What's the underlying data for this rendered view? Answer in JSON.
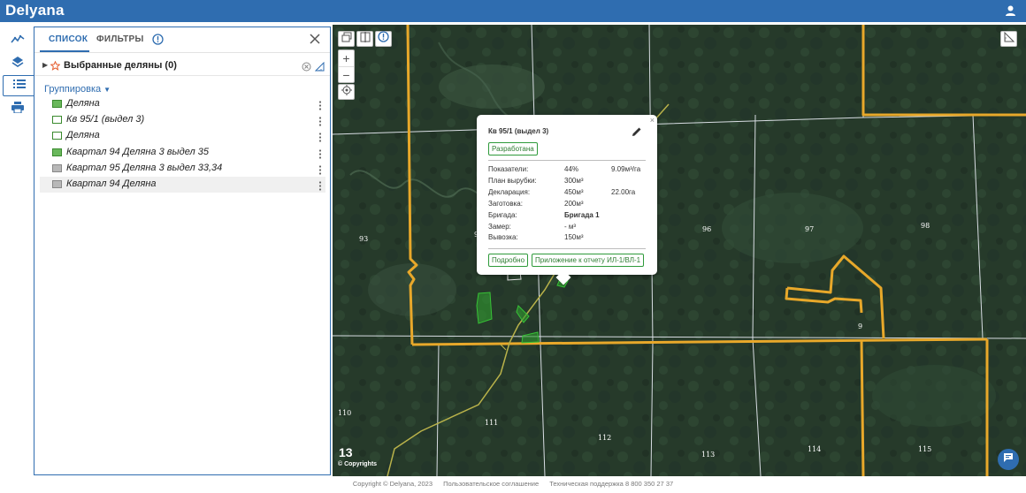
{
  "header": {
    "logo": "Delyana",
    "user_icon": "user-icon"
  },
  "rail": {
    "items": [
      {
        "name": "analytics",
        "icon": "chart-line-icon"
      },
      {
        "name": "layers",
        "icon": "layers-icon"
      },
      {
        "name": "list",
        "icon": "list-icon",
        "active": true
      },
      {
        "name": "print",
        "icon": "print-icon"
      }
    ]
  },
  "panel": {
    "tabs": [
      "СПИСОК",
      "ФИЛЬТРЫ"
    ],
    "active_tab": "СПИСОК",
    "favorites_label": "Выбранные деляны (0)",
    "grouping_label": "Группировка",
    "items": [
      {
        "label": "Деляна",
        "swatch": "green"
      },
      {
        "label": "Кв 95/1 (выдел 3)",
        "swatch": "white"
      },
      {
        "label": "Деляна",
        "swatch": "white"
      },
      {
        "label": "Квартал 94 Деляна 3 выдел 35",
        "swatch": "green"
      },
      {
        "label": "Квартал 95 Деляна 3 выдел 33,34",
        "swatch": "grey"
      },
      {
        "label": "Квартал 94 Деляна",
        "swatch": "grey",
        "highlighted": true
      }
    ]
  },
  "map": {
    "zoom_in": "+",
    "zoom_out": "−",
    "zoom_level": "13",
    "copyright": "© Copyrights",
    "quarters": [
      "93",
      "9",
      "96",
      "97",
      "98",
      "9",
      "110",
      "111",
      "112",
      "113",
      "114",
      "115"
    ],
    "colors": {
      "boundary": "#e8a82a",
      "grid": "#d8dde3",
      "selection": "#2f9a2f",
      "road": "#b9b24a"
    }
  },
  "popup": {
    "title": "Кв 95/1 (выдел 3)",
    "status": "Разработана",
    "rows": [
      {
        "label": "Показатели:",
        "v1": "44%",
        "v2": "9.09м³/га"
      },
      {
        "label": "План вырубки:",
        "v1": "300м³",
        "v2": ""
      },
      {
        "label": "Декларация:",
        "v1": "450м³",
        "v2": "22.00га"
      },
      {
        "label": "Заготовка:",
        "v1": "200м³",
        "v2": ""
      },
      {
        "label": "Бригада:",
        "v1": "Бригада 1",
        "v2": ""
      },
      {
        "label": "Замер:",
        "v1": "- м³",
        "v2": ""
      },
      {
        "label": "Вывозка:",
        "v1": "150м³",
        "v2": ""
      }
    ],
    "details_button": "Подробно",
    "report_button": "Приложение к отчету ИЛ-1/ВЛ-1",
    "close": "×"
  },
  "footer": {
    "copyright": "Copyright © Delyana, 2023",
    "agreement": "Пользовательское соглашение",
    "support": "Техническая поддержка 8 800 350 27 37"
  }
}
